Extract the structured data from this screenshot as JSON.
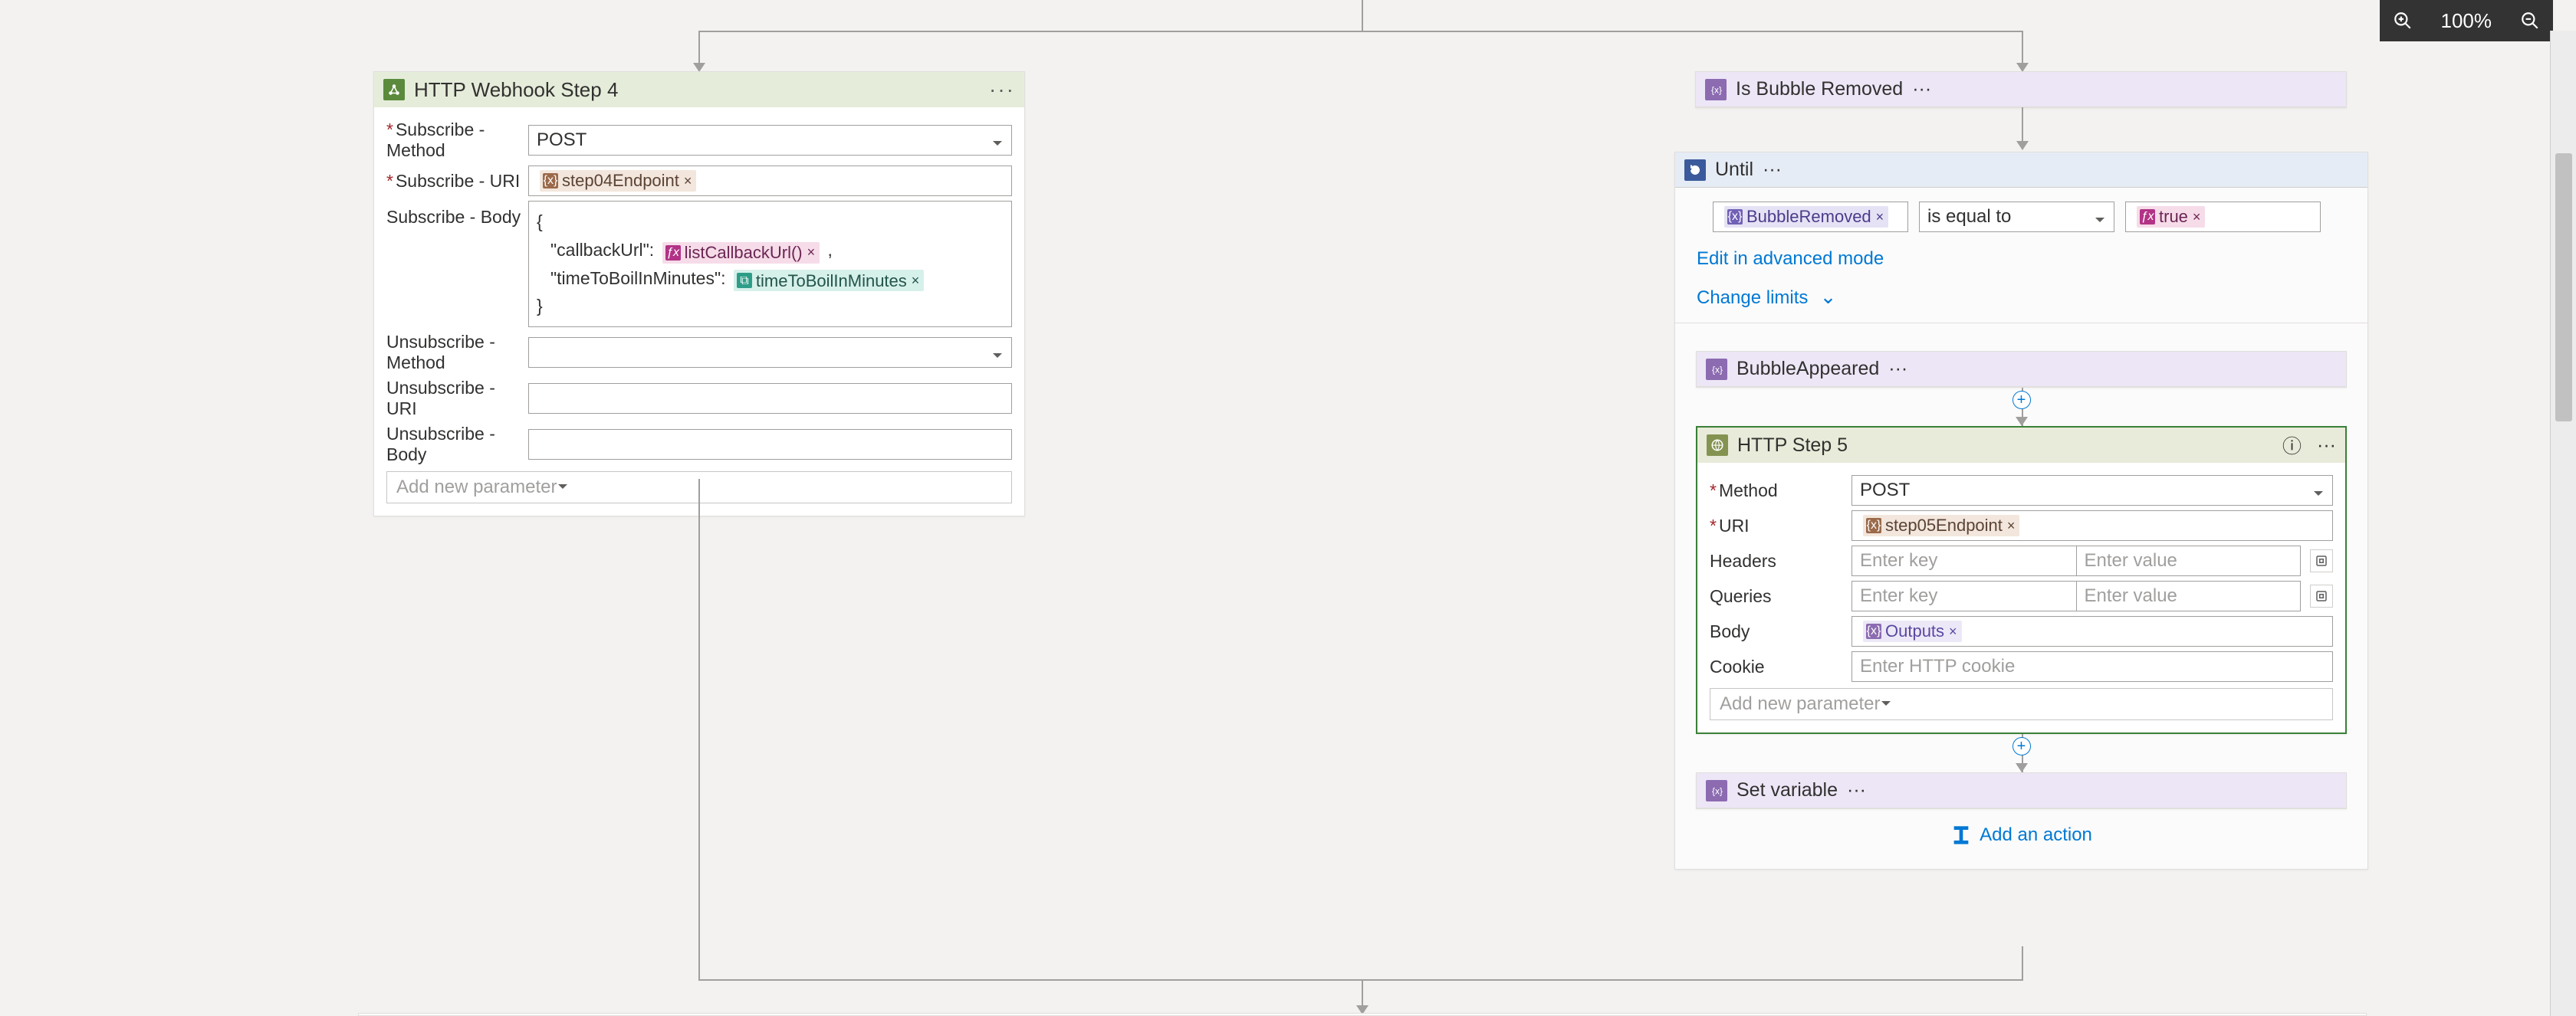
{
  "zoom": {
    "level": "100%"
  },
  "colors": {
    "purple": "#8c6bb1",
    "fx": "#b23386",
    "teal": "#2d9d88",
    "brown": "#9b6a4a"
  },
  "left_card": {
    "title": "HTTP Webhook Step 4",
    "fields": {
      "subscribe_method_label": "Subscribe - Method",
      "subscribe_method_value": "POST",
      "subscribe_uri_label": "Subscribe - URI",
      "subscribe_uri_chip": "step04Endpoint",
      "subscribe_body_label": "Subscribe - Body",
      "body_open": "{",
      "body_key1": "\"callbackUrl\":",
      "body_chip1": "listCallbackUrl()",
      "body_comma": ",",
      "body_key2": "\"timeToBoilInMinutes\":",
      "body_chip2": "timeToBoilInMinutes",
      "body_close": "}",
      "unsubscribe_method_label": "Unsubscribe - Method",
      "unsubscribe_uri_label": "Unsubscribe - URI",
      "unsubscribe_body_label": "Unsubscribe - Body",
      "add_new_parameter": "Add new parameter"
    }
  },
  "right": {
    "is_bubble_removed": "Is Bubble Removed",
    "until_title": "Until",
    "until_left_chip": "BubbleRemoved",
    "until_op": "is equal to",
    "until_right_chip": "true",
    "edit_advanced": "Edit in advanced mode",
    "change_limits": "Change limits",
    "bubble_appeared": "BubbleAppeared",
    "http5": {
      "title": "HTTP Step 5",
      "method_label": "Method",
      "method_value": "POST",
      "uri_label": "URI",
      "uri_chip": "step05Endpoint",
      "headers_label": "Headers",
      "queries_label": "Queries",
      "key_placeholder": "Enter key",
      "value_placeholder": "Enter value",
      "body_label": "Body",
      "body_chip": "Outputs",
      "cookie_label": "Cookie",
      "cookie_placeholder": "Enter HTTP cookie",
      "add_new_parameter": "Add new parameter"
    },
    "set_variable": "Set variable",
    "add_action": "Add an action"
  }
}
